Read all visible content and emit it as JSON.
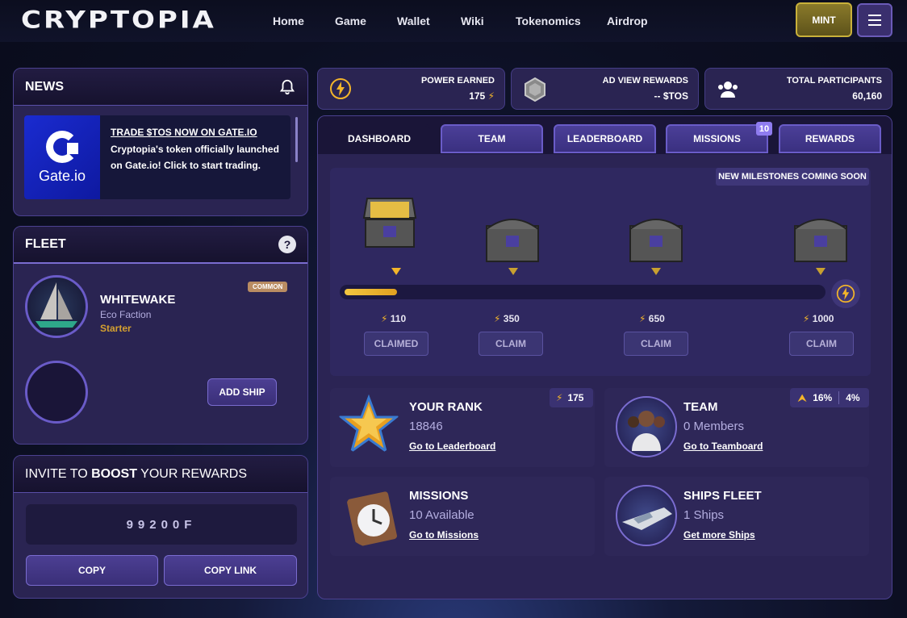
{
  "header": {
    "logo": "CRYPTOPIA",
    "nav": [
      "Home",
      "Game",
      "Wallet",
      "Wiki",
      "Tokenomics",
      "Airdrop"
    ],
    "mint_label": "MINT"
  },
  "news": {
    "title": "NEWS",
    "logo_text": "Gate.io",
    "link": "TRADE $TOS NOW ON GATE.IO",
    "body": "Cryptopia's token officially launched on Gate.io! Click to start trading."
  },
  "fleet": {
    "title": "FLEET",
    "help": "?",
    "ship_name": "WHITEWAKE",
    "faction": "Eco Faction",
    "tier": "Starter",
    "rarity": "COMMON",
    "add_ship": "ADD SHIP"
  },
  "invite": {
    "title_prefix": "INVITE TO ",
    "title_bold": "BOOST",
    "title_suffix": " YOUR REWARDS",
    "code": "99200F",
    "copy": "COPY",
    "copy_link": "COPY LINK"
  },
  "stats": {
    "power_label": "POWER EARNED",
    "power_value": "175",
    "ad_label": "AD VIEW REWARDS",
    "ad_value": "-- $TOS",
    "participants_label": "TOTAL PARTICIPANTS",
    "participants_value": "60,160"
  },
  "tabs": {
    "dashboard": "DASHBOARD",
    "team": "TEAM",
    "leaderboard": "LEADERBOARD",
    "missions": "MISSIONS",
    "missions_badge": "10",
    "rewards": "REWARDS"
  },
  "milestones": {
    "banner": "NEW MILESTONES COMING SOON",
    "progress": 0.11,
    "items": [
      {
        "points": "110",
        "button": "CLAIMED"
      },
      {
        "points": "350",
        "button": "CLAIM"
      },
      {
        "points": "650",
        "button": "CLAIM"
      },
      {
        "points": "1000",
        "button": "CLAIM"
      }
    ]
  },
  "cards": {
    "rank": {
      "title": "YOUR RANK",
      "value": "18846",
      "link": "Go to Leaderboard",
      "pill": "175"
    },
    "team": {
      "title": "TEAM",
      "value": "0 Members",
      "link": "Go to Teamboard",
      "pill_a": "16%",
      "pill_b": "4%"
    },
    "missions": {
      "title": "MISSIONS",
      "value": "10 Available",
      "link": "Go to Missions"
    },
    "ships": {
      "title": "SHIPS FLEET",
      "value": "1 Ships",
      "link": "Get more Ships"
    }
  },
  "colors": {
    "accent": "#6a5cc8",
    "gold": "#f3b52a",
    "panel": "#2a2452"
  }
}
